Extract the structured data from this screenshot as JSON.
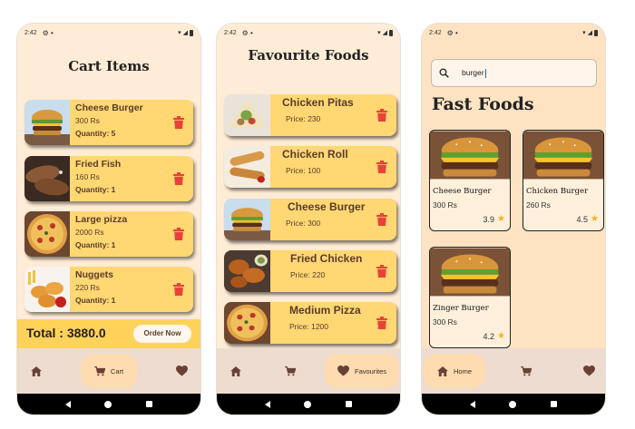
{
  "cart": {
    "status_time": "2:42",
    "title": "Cart Items",
    "items": [
      {
        "name": "Cheese Burger",
        "price": "300 Rs",
        "quantity": "Quantity: 5"
      },
      {
        "name": "Fried Fish",
        "price": "160 Rs",
        "quantity": "Quantity: 1"
      },
      {
        "name": "Large pizza",
        "price": "2000 Rs",
        "quantity": "Quantity: 1"
      },
      {
        "name": "Nuggets",
        "price": "220 Rs",
        "quantity": "Quantity: 1"
      }
    ],
    "total_label": "Total : 3880.0",
    "order_button": "Order Now",
    "nav": {
      "cart_label": "Cart"
    }
  },
  "favourites": {
    "status_time": "2:42",
    "title": "Favourite Foods",
    "items": [
      {
        "name": "Chicken Pitas",
        "price": "Price: 230"
      },
      {
        "name": "Chicken Roll",
        "price": "Price: 100"
      },
      {
        "name": "Cheese Burger",
        "price": "Price: 300"
      },
      {
        "name": "Fried Chicken",
        "price": "Price: 220"
      },
      {
        "name": "Medium Pizza",
        "price": "Price: 1200"
      }
    ],
    "nav": {
      "favourites_label": "Favourites"
    }
  },
  "fastfoods": {
    "status_time": "2:42",
    "search": {
      "value": "burger"
    },
    "title": "Fast Foods",
    "items": [
      {
        "name": "Cheese Burger",
        "price": "300 Rs",
        "rating": "3.9"
      },
      {
        "name": "Chicken Burger",
        "price": "260 Rs",
        "rating": "4.5"
      },
      {
        "name": "Zinger Burger",
        "price": "300 Rs",
        "rating": "4.2"
      }
    ],
    "nav": {
      "home_label": "Home"
    }
  },
  "colors": {
    "background": "#ffecd6",
    "card": "#ffd773",
    "total_bar": "#ffd25a",
    "navbar": "#eedcd0",
    "nav_pill": "#ffdcb0",
    "trash": "#e8413a",
    "nav_icon": "#6b4036",
    "star": "#f3b31b"
  },
  "icons": [
    "home-icon",
    "cart-icon",
    "heart-icon",
    "trash-icon",
    "search-icon",
    "star-icon"
  ]
}
